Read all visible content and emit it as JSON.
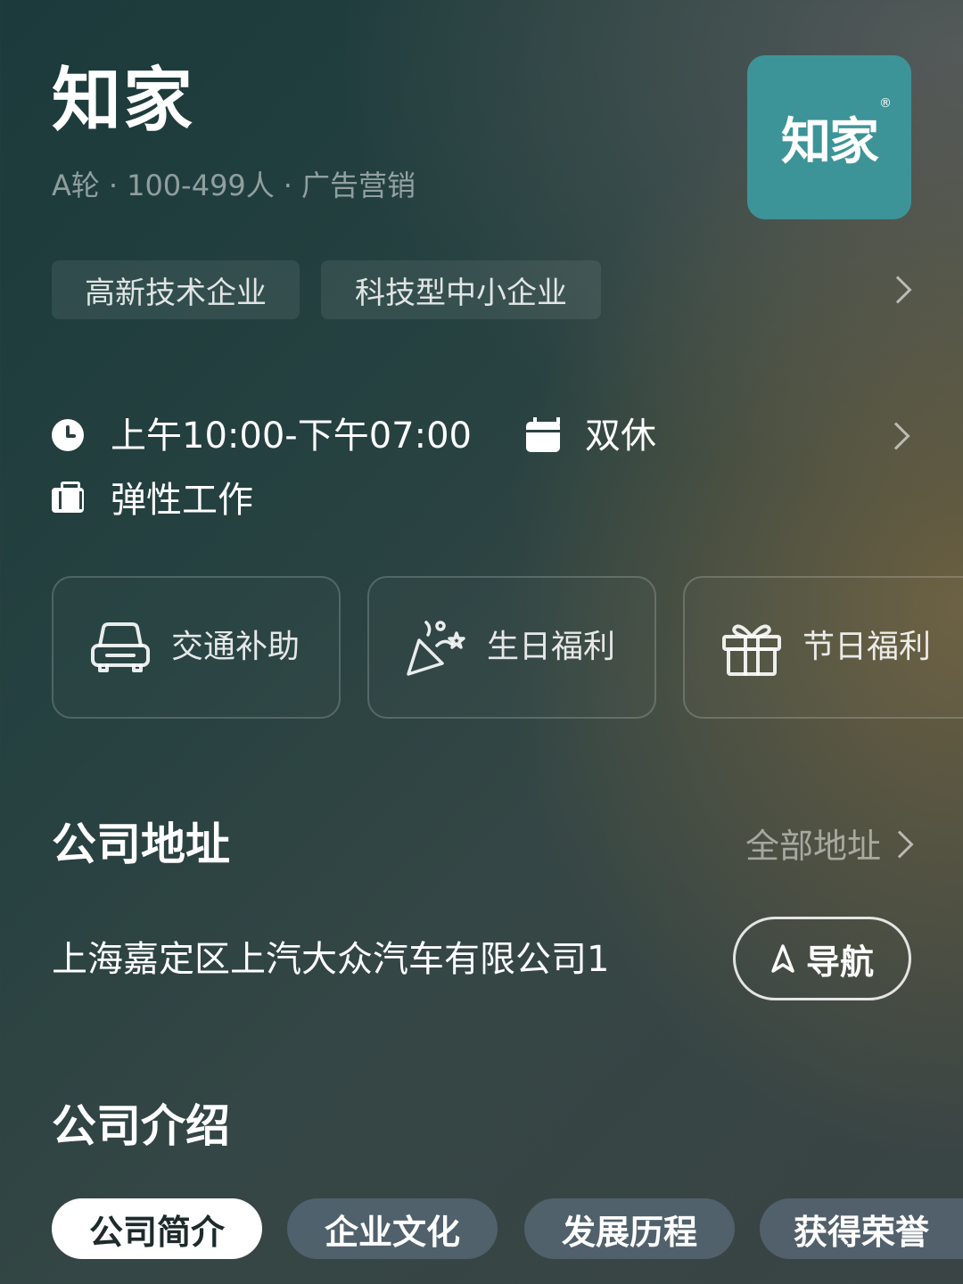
{
  "company": {
    "name": "知家",
    "meta": [
      "A轮",
      "100-499人",
      "广告营销"
    ],
    "meta_separator": "·",
    "logo_text": "知家",
    "logo_mark": "®"
  },
  "tags": [
    "高新技术企业",
    "科技型中小企业"
  ],
  "work_info": {
    "hours": "上午10:00-下午07:00",
    "rest": "双休",
    "work_type": "弹性工作"
  },
  "benefits": [
    {
      "label": "交通补助",
      "icon": "car-icon"
    },
    {
      "label": "生日福利",
      "icon": "party-popper-icon"
    },
    {
      "label": "节日福利",
      "icon": "gift-icon"
    }
  ],
  "address_section": {
    "title": "公司地址",
    "all_link": "全部地址",
    "address": "上海嘉定区上汽大众汽车有限公司1",
    "nav_label": "导航"
  },
  "intro_section": {
    "title": "公司介绍",
    "tabs": [
      "公司简介",
      "企业文化",
      "发展历程",
      "获得荣誉"
    ],
    "active_tab": "公司简介"
  },
  "colors": {
    "logo_bg": "#3d9498",
    "background_dark": "#1c3a3b",
    "warm_glow": "#96733c"
  }
}
